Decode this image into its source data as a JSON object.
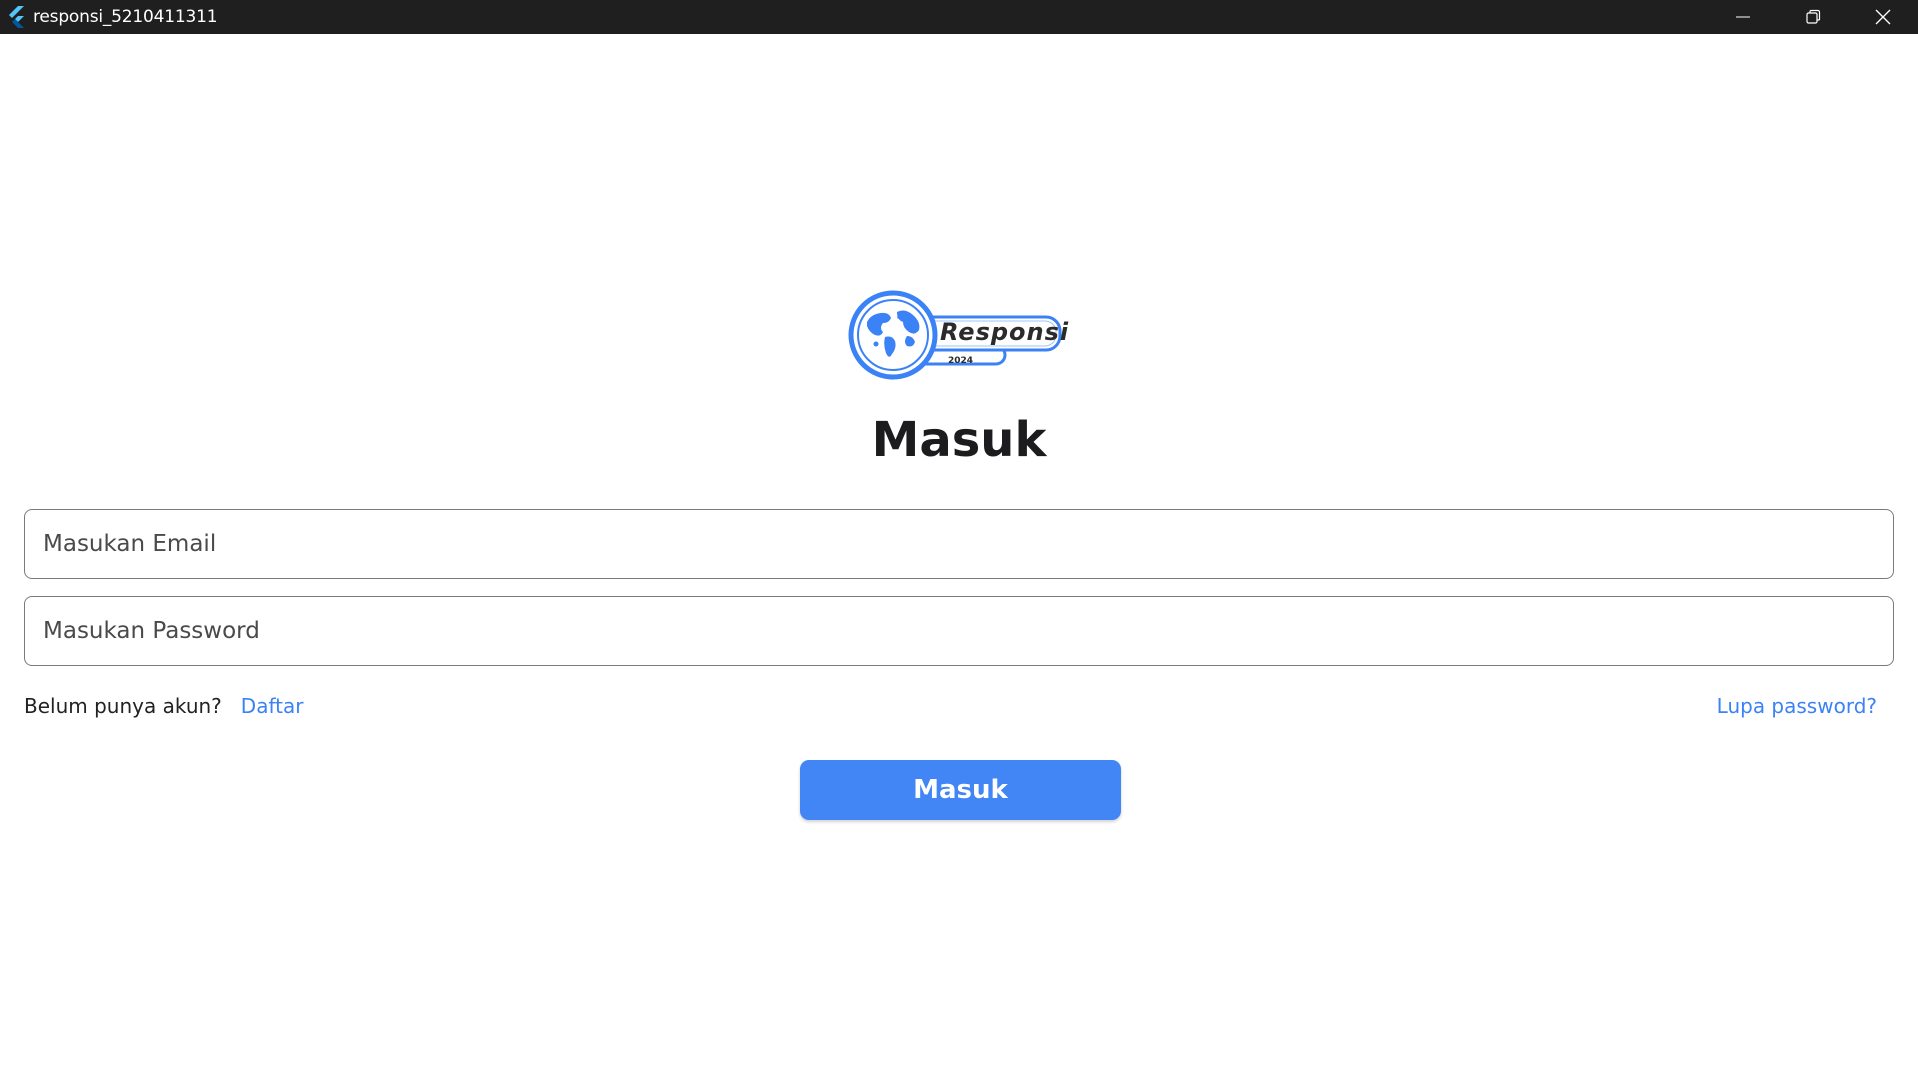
{
  "window": {
    "title": "responsi_5210411311",
    "app_icon": "flutter-icon",
    "controls": [
      "minimize-icon",
      "restore-icon",
      "close-icon"
    ]
  },
  "logo": {
    "title": "Responsi",
    "year": "2024",
    "icon": "globe-icon",
    "color": "#3b82f6"
  },
  "login": {
    "heading": "Masuk",
    "email_placeholder": "Masukan Email",
    "password_placeholder": "Masukan Password",
    "signup_prompt": "Belum punya akun?",
    "signup_link": "Daftar",
    "forgot_link": "Lupa password?",
    "submit_label": "Masuk"
  },
  "colors": {
    "accent": "#4285f4",
    "link": "#3b82f6",
    "titlebar": "#1f1f1f"
  }
}
